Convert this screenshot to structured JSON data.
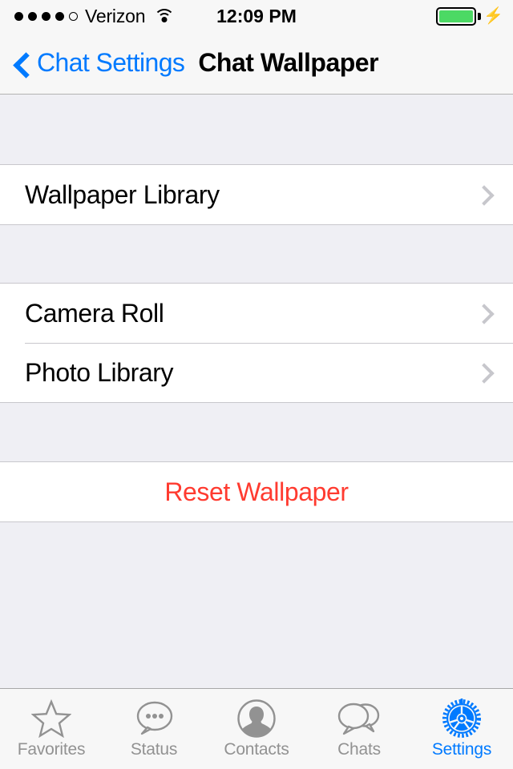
{
  "status_bar": {
    "carrier": "Verizon",
    "signal_dots_total": 5,
    "signal_dots_filled": 4,
    "wifi_icon": "wifi-icon",
    "time": "12:09 PM",
    "battery_icon": "battery-full-icon",
    "battery_color": "#4CD964",
    "charging_icon": "lightning-bolt-icon"
  },
  "nav_bar": {
    "back_icon": "chevron-left-icon",
    "back_label": "Chat Settings",
    "title": "Chat Wallpaper"
  },
  "sections": [
    {
      "rows": [
        {
          "label": "Wallpaper Library",
          "accessory": "chevron-right-icon",
          "style": "default"
        }
      ]
    },
    {
      "rows": [
        {
          "label": "Camera Roll",
          "accessory": "chevron-right-icon",
          "style": "default"
        },
        {
          "label": "Photo Library",
          "accessory": "chevron-right-icon",
          "style": "default"
        }
      ]
    },
    {
      "rows": [
        {
          "label": "Reset Wallpaper",
          "accessory": "",
          "style": "destructive"
        }
      ]
    }
  ],
  "tab_bar": {
    "tabs": [
      {
        "label": "Favorites",
        "icon": "star-outline-icon",
        "active": false
      },
      {
        "label": "Status",
        "icon": "speech-bubble-dots-icon",
        "active": false
      },
      {
        "label": "Contacts",
        "icon": "person-circle-icon",
        "active": false
      },
      {
        "label": "Chats",
        "icon": "double-speech-bubble-icon",
        "active": false
      },
      {
        "label": "Settings",
        "icon": "gear-icon",
        "active": true
      }
    ]
  },
  "colors": {
    "accent_blue": "#007AFF",
    "destructive_red": "#FF3B30",
    "inactive_gray": "#929292",
    "group_background": "#EFEFF4",
    "cell_background": "#FFFFFF",
    "separator": "#C8C7CC"
  }
}
